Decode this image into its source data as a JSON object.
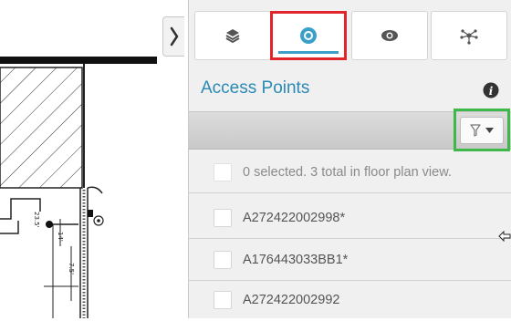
{
  "panel": {
    "tabs": [
      {
        "icon": "layers-icon",
        "active": false
      },
      {
        "icon": "access-point-icon",
        "active": true
      },
      {
        "icon": "eye-icon",
        "active": false
      },
      {
        "icon": "network-icon",
        "active": false
      }
    ],
    "section_title": "Access Points",
    "info_icon": "info-icon",
    "filter": {
      "icon": "filter-icon",
      "dropdown_icon": "caret-down-icon"
    },
    "summary_text": "0 selected. 3 total in floor plan view.",
    "access_points": [
      {
        "label": "A272422002998*"
      },
      {
        "label": "A176443033BB1*"
      },
      {
        "label": "A272422002992"
      }
    ]
  },
  "floorplan": {
    "labels": [
      "23.5'",
      "14'",
      "7.5'"
    ]
  },
  "colors": {
    "accent": "#2a8ab6",
    "active_tab_highlight": "#e0262a",
    "filter_highlight": "#3fb84a",
    "tab_underline": "#3aa0c8"
  }
}
